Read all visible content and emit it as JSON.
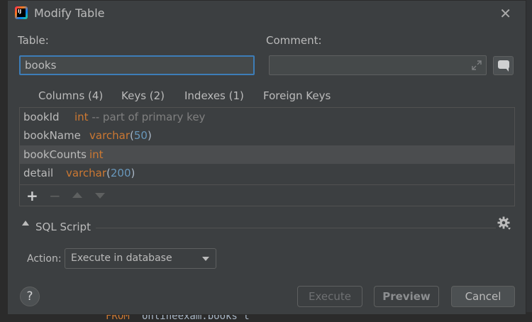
{
  "window": {
    "title": "Modify Table"
  },
  "table_field": {
    "label": "Table:",
    "value": "books"
  },
  "comment_field": {
    "label": "Comment:",
    "value": ""
  },
  "tabs": [
    {
      "label": "Columns (4)",
      "active": true
    },
    {
      "label": "Keys (2)",
      "active": false
    },
    {
      "label": "Indexes (1)",
      "active": false
    },
    {
      "label": "Foreign Keys",
      "active": false
    }
  ],
  "columns": [
    {
      "name": "bookId",
      "type": "int",
      "size": "",
      "comment": "-- part of primary key"
    },
    {
      "name": "bookName",
      "type": "varchar",
      "size": "50",
      "comment": ""
    },
    {
      "name": "bookCounts",
      "type": "int",
      "size": "",
      "comment": ""
    },
    {
      "name": "detail",
      "type": "varchar",
      "size": "200",
      "comment": ""
    }
  ],
  "toolbar": {
    "add": "+",
    "remove": "−"
  },
  "sql_section": {
    "label": "SQL Script"
  },
  "action": {
    "label": "Action:",
    "selected": "Execute in database"
  },
  "buttons": {
    "help": "?",
    "execute": "Execute",
    "preview": "Preview",
    "cancel": "Cancel"
  },
  "background_code": {
    "keyword": "FROM",
    "text": "onlineexam.books t"
  },
  "colors": {
    "accent": "#4a88c7",
    "focus_border": "#3d7db8",
    "type_orange": "#cc7832",
    "number_blue": "#6897bb",
    "comment_gray": "#808080"
  }
}
